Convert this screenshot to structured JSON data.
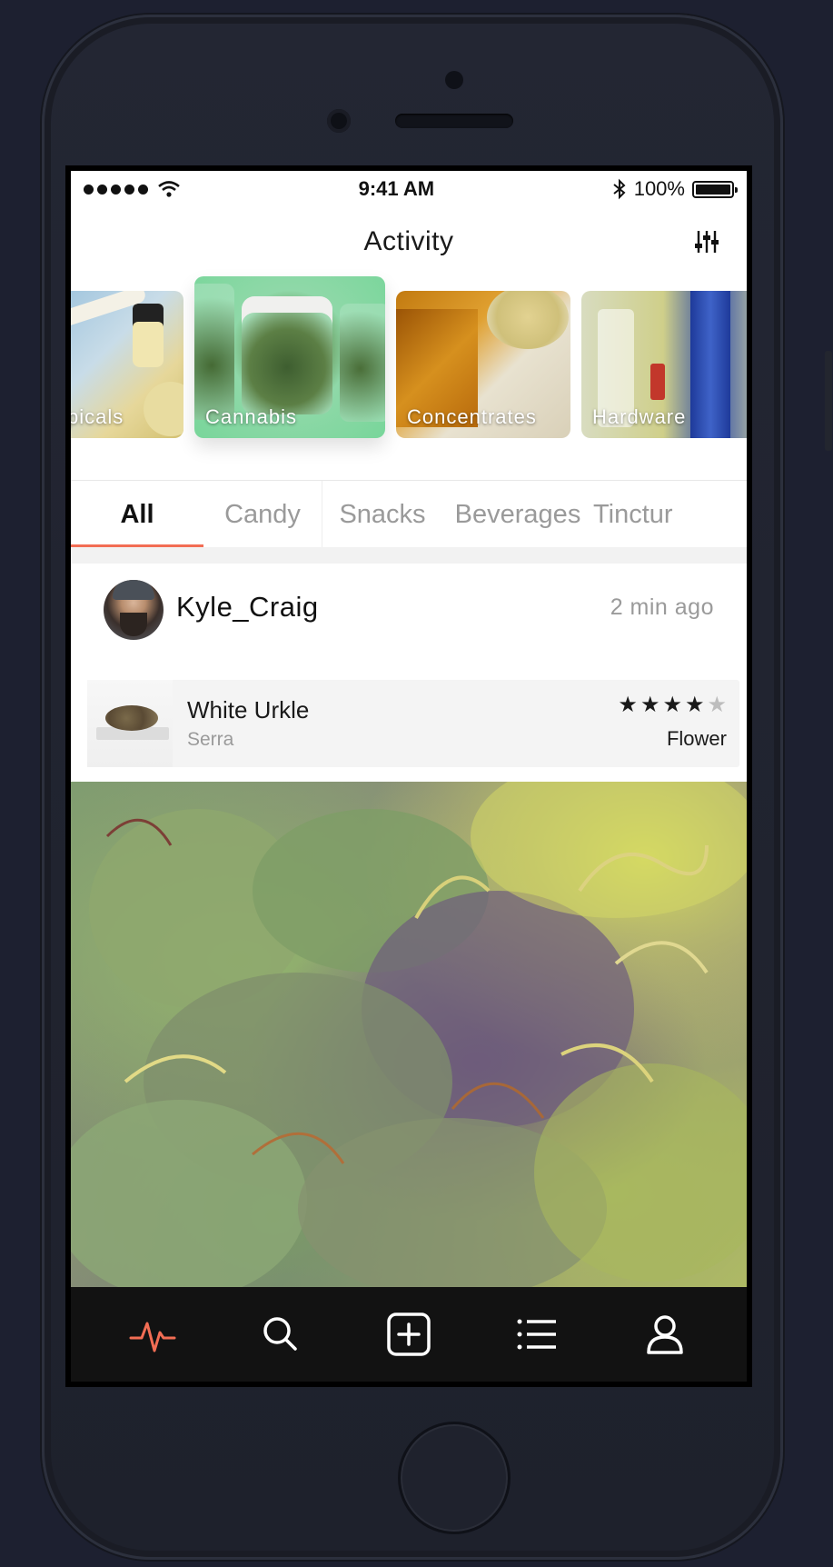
{
  "status_bar": {
    "time": "9:41 AM",
    "battery": "100%"
  },
  "nav": {
    "title": "Activity",
    "filter_icon": "sliders-icon"
  },
  "categories": [
    {
      "label": "picals"
    },
    {
      "label": "Cannabis"
    },
    {
      "label": "Concentrates"
    },
    {
      "label": "Hardware"
    }
  ],
  "tabs": [
    {
      "label": "All",
      "active": true
    },
    {
      "label": "Candy"
    },
    {
      "label": "Snacks"
    },
    {
      "label": "Beverages"
    },
    {
      "label": "Tinctur"
    }
  ],
  "post": {
    "username": "Kyle_Craig",
    "time": "2 min ago",
    "product": {
      "name": "White Urkle",
      "brand": "Serra",
      "rating": 4,
      "rating_max": 5,
      "type": "Flower"
    }
  },
  "tabbar": {
    "items": [
      {
        "icon": "activity-icon",
        "active": true,
        "accent": "#f26d54"
      },
      {
        "icon": "search-icon"
      },
      {
        "icon": "add-icon"
      },
      {
        "icon": "list-icon"
      },
      {
        "icon": "profile-icon"
      }
    ]
  }
}
